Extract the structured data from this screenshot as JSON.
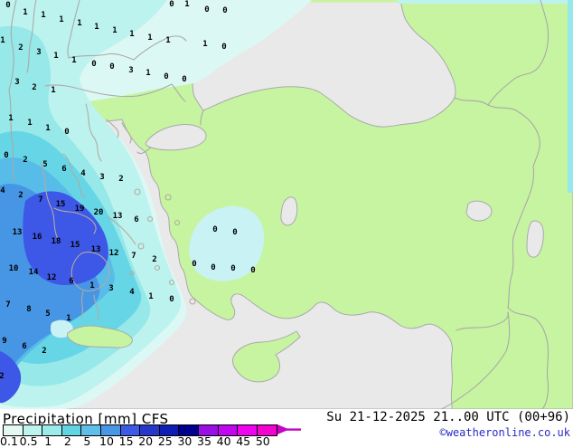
{
  "legend": {
    "title": "Precipitation [mm] CFS",
    "ticks": [
      "0.1",
      "0.5",
      "1",
      "2",
      "5",
      "10",
      "15",
      "20",
      "25",
      "30",
      "35",
      "40",
      "45",
      "50"
    ],
    "palette": [
      "#E4F9F4",
      "#BDF4EF",
      "#9CEBEB",
      "#62D5E5",
      "#5FBEEA",
      "#4797E6",
      "#3C59E8",
      "#2737CB",
      "#0E1DB5",
      "#00008F",
      "#9A0FE6",
      "#C306F0",
      "#EC05EE",
      "#F403CF"
    ],
    "arrow_color": "#C504C5"
  },
  "status": {
    "datetime": "Su 21-12-2025 21..00 UTC (00+96)",
    "credit": "©weatheronline.co.uk",
    "credit_color": "#2A2AC4"
  },
  "map": {
    "sea_color": "#E9E9E9",
    "land_color": "#C7F4A0",
    "border_color": "#A9A9A9",
    "coast_color": "#B3AA9E",
    "level_colors": [
      "#DCF8F4",
      "#BDF3EF",
      "#97E8E9",
      "#66D5E6",
      "#58BCE9",
      "#4795E5",
      "#3D57E6"
    ],
    "sw_patch_color": "#C9F2F4",
    "values": [
      [
        9,
        5,
        "0"
      ],
      [
        190,
        4,
        "0"
      ],
      [
        207,
        4,
        "1"
      ],
      [
        28,
        13,
        "1"
      ],
      [
        48,
        16,
        "1"
      ],
      [
        68,
        21,
        "1"
      ],
      [
        88,
        25,
        "1"
      ],
      [
        107,
        29,
        "1"
      ],
      [
        127,
        33,
        "1"
      ],
      [
        146,
        37,
        "1"
      ],
      [
        166,
        41,
        "1"
      ],
      [
        186,
        44,
        "1"
      ],
      [
        229,
        10,
        "0"
      ],
      [
        249,
        11,
        "0"
      ],
      [
        3,
        44,
        "1"
      ],
      [
        23,
        52,
        "2"
      ],
      [
        43,
        57,
        "3"
      ],
      [
        62,
        61,
        "1"
      ],
      [
        82,
        66,
        "1"
      ],
      [
        104,
        70,
        "0"
      ],
      [
        124,
        73,
        "0"
      ],
      [
        145,
        77,
        "3"
      ],
      [
        164,
        80,
        "1"
      ],
      [
        184,
        84,
        "0"
      ],
      [
        204,
        87,
        "0"
      ],
      [
        227,
        48,
        "1"
      ],
      [
        248,
        51,
        "0"
      ],
      [
        19,
        90,
        "3"
      ],
      [
        38,
        96,
        "2"
      ],
      [
        59,
        99,
        "1"
      ],
      [
        12,
        130,
        "1"
      ],
      [
        33,
        135,
        "1"
      ],
      [
        53,
        141,
        "1"
      ],
      [
        74,
        145,
        "0"
      ],
      [
        7,
        171,
        "0"
      ],
      [
        28,
        176,
        "2"
      ],
      [
        50,
        181,
        "5"
      ],
      [
        71,
        186,
        "6"
      ],
      [
        92,
        191,
        "4"
      ],
      [
        113,
        195,
        "3"
      ],
      [
        134,
        197,
        "2"
      ],
      [
        3,
        210,
        "4"
      ],
      [
        23,
        215,
        "2"
      ],
      [
        45,
        220,
        "7"
      ],
      [
        67,
        225,
        "15"
      ],
      [
        88,
        230,
        "19"
      ],
      [
        109,
        234,
        "20"
      ],
      [
        130,
        238,
        "13"
      ],
      [
        151,
        242,
        "6"
      ],
      [
        19,
        256,
        "13"
      ],
      [
        41,
        261,
        "16"
      ],
      [
        62,
        266,
        "18"
      ],
      [
        83,
        270,
        "15"
      ],
      [
        106,
        275,
        "13"
      ],
      [
        126,
        279,
        "12"
      ],
      [
        148,
        282,
        "7"
      ],
      [
        171,
        286,
        "2"
      ],
      [
        15,
        296,
        "10"
      ],
      [
        37,
        300,
        "14"
      ],
      [
        57,
        306,
        "12"
      ],
      [
        79,
        310,
        "6"
      ],
      [
        102,
        315,
        "1"
      ],
      [
        123,
        318,
        "3"
      ],
      [
        146,
        322,
        "4"
      ],
      [
        167,
        327,
        "1"
      ],
      [
        190,
        330,
        "0"
      ],
      [
        9,
        336,
        "7"
      ],
      [
        32,
        341,
        "8"
      ],
      [
        53,
        346,
        "5"
      ],
      [
        76,
        351,
        "1"
      ],
      [
        5,
        376,
        "9"
      ],
      [
        27,
        382,
        "6"
      ],
      [
        49,
        387,
        "2"
      ],
      [
        2,
        415,
        "2"
      ],
      [
        238,
        253,
        "0"
      ],
      [
        260,
        256,
        "0"
      ],
      [
        215,
        291,
        "0"
      ],
      [
        236,
        295,
        "0"
      ],
      [
        258,
        296,
        "0"
      ],
      [
        280,
        298,
        "0"
      ]
    ]
  }
}
